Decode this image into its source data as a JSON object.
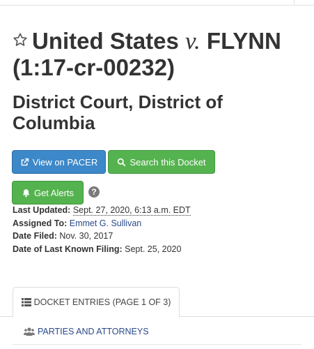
{
  "case": {
    "title_pre": "United States",
    "title_v": "v.",
    "title_post": "FLYNN (1:17-cr-00232)",
    "court": "District Court, District of Columbia"
  },
  "buttons": {
    "view_pacer": "View on PACER",
    "search_docket": "Search this Docket",
    "get_alerts": "Get Alerts",
    "help_symbol": "?"
  },
  "meta": {
    "last_updated_label": "Last Updated:",
    "last_updated_value": "Sept. 27, 2020, 6:13 a.m. EDT",
    "assigned_label": "Assigned To:",
    "assigned_value": "Emmet G. Sullivan",
    "filed_label": "Date Filed:",
    "filed_value": "Nov. 30, 2017",
    "last_filing_label": "Date of Last Known Filing:",
    "last_filing_value": "Sept. 25, 2020"
  },
  "tabs": {
    "docket": "DOCKET ENTRIES (PAGE 1 OF 3)",
    "parties": "PARTIES AND ATTORNEYS"
  },
  "colors": {
    "primary": "#3c88c9",
    "success": "#55b34f",
    "link": "#2a4a8a"
  },
  "icons": {
    "star": "star-icon",
    "external_link": "external-link-icon",
    "search": "search-icon",
    "bell": "bell-icon",
    "list": "list-icon",
    "users": "users-icon"
  }
}
